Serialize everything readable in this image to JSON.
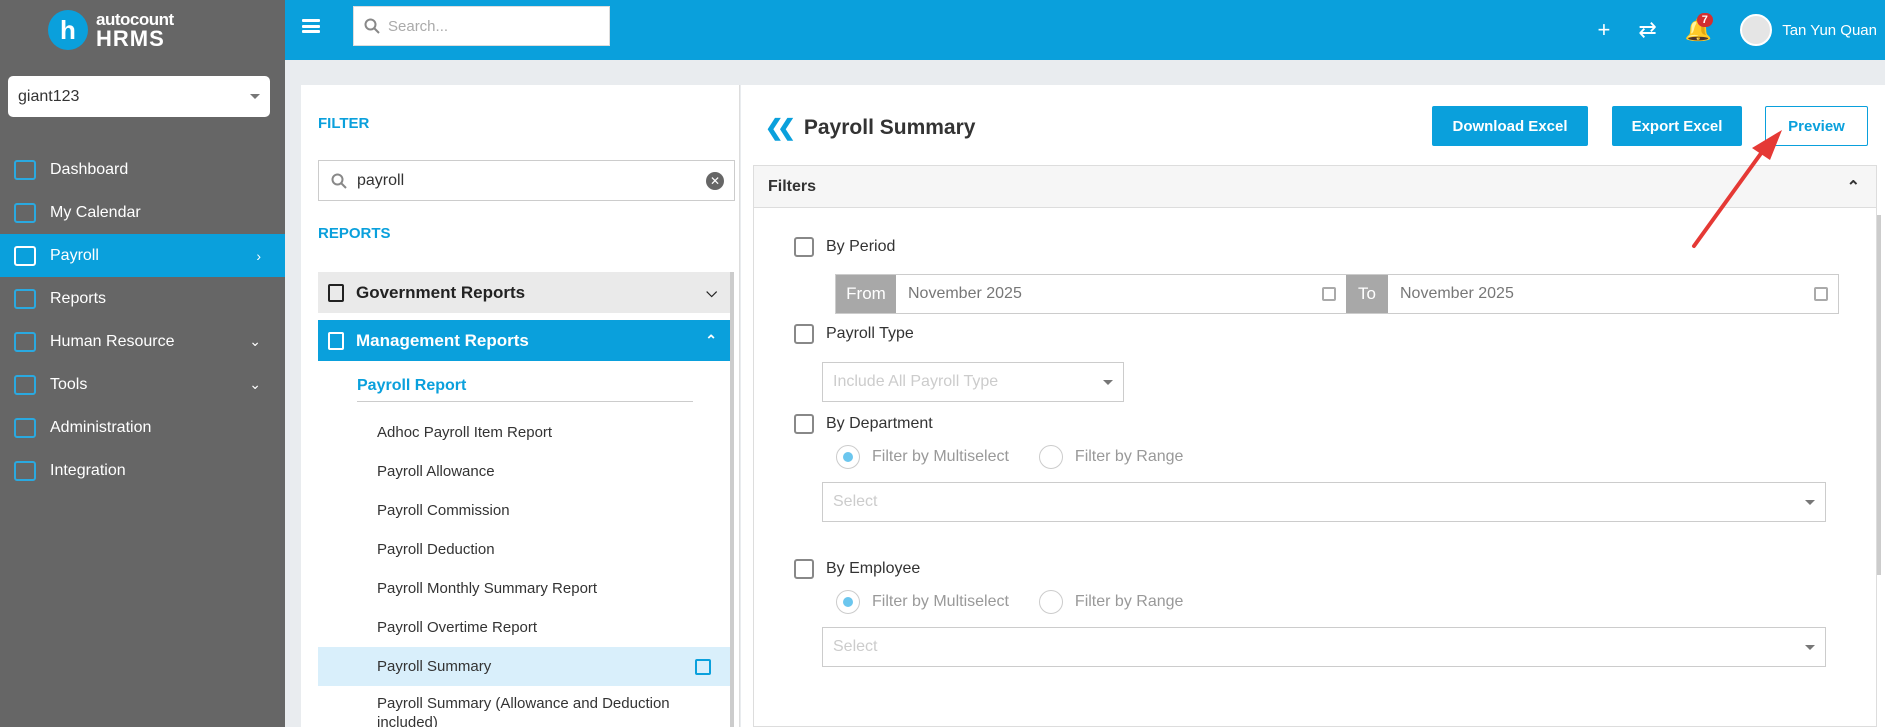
{
  "brand": {
    "logo_letter": "h",
    "line1": "autocount",
    "line2": "HRMS"
  },
  "company": {
    "selected": "giant123"
  },
  "sidebar": {
    "items": [
      {
        "label": "Dashboard",
        "icon": "dashboard-icon"
      },
      {
        "label": "My Calendar",
        "icon": "calendar-icon"
      },
      {
        "label": "Payroll",
        "icon": "payroll-icon",
        "active": true,
        "chevron": ">"
      },
      {
        "label": "Reports",
        "icon": "reports-icon"
      },
      {
        "label": "Human Resource",
        "icon": "human-resource-icon",
        "chevron": "v"
      },
      {
        "label": "Tools",
        "icon": "tools-icon",
        "chevron": "v"
      },
      {
        "label": "Administration",
        "icon": "administration-icon"
      },
      {
        "label": "Integration",
        "icon": "integration-icon"
      }
    ]
  },
  "topbar": {
    "search_placeholder": "Search...",
    "notifications_count": "7",
    "user_name": "Tan Yun Quan",
    "accent": "#0aa0dc"
  },
  "filter_panel": {
    "filter_heading": "FILTER",
    "filter_value": "payroll",
    "reports_heading": "REPORTS",
    "government_reports": "Government Reports",
    "management_reports": "Management Reports",
    "subgroup": "Payroll Report",
    "reports": [
      "Adhoc Payroll Item Report",
      "Payroll Allowance",
      "Payroll Commission",
      "Payroll Deduction",
      "Payroll Monthly Summary Report",
      "Payroll Overtime Report",
      "Payroll Summary",
      "Payroll Summary (Allowance and Deduction included)"
    ],
    "active_report": "Payroll Summary"
  },
  "main": {
    "title": "Payroll Summary",
    "download_excel": "Download Excel",
    "export_excel": "Export Excel",
    "preview": "Preview",
    "filters_title": "Filters",
    "by_period": "By Period",
    "from_label": "From",
    "from_value": "November 2025",
    "to_label": "To",
    "to_value": "November 2025",
    "payroll_type": "Payroll Type",
    "payroll_type_placeholder": "Include All Payroll Type",
    "by_department": "By Department",
    "by_employee": "By Employee",
    "filter_multiselect": "Filter by Multiselect",
    "filter_range": "Filter by Range",
    "select_placeholder": "Select"
  }
}
